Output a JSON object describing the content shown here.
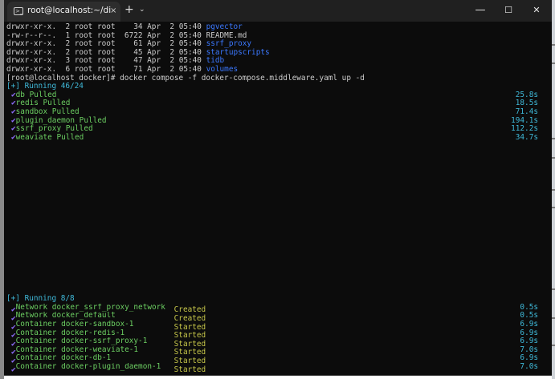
{
  "window": {
    "tab_title": "root@localhost:~/dify/docker",
    "tab_close": "×",
    "new_tab": "+",
    "tab_dropdown": "⌄",
    "minimize": "—",
    "maximize": "☐",
    "close": "✕"
  },
  "listing": [
    {
      "perms": "drwxr-xr-x.",
      "links": "2",
      "owner": "root",
      "group": "root",
      "size": "34",
      "month": "Apr",
      "day": "2",
      "time": "05:40",
      "name": "pgvector",
      "color": "#3b78ff"
    },
    {
      "perms": "-rw-r--r--.",
      "links": "1",
      "owner": "root",
      "group": "root",
      "size": "6722",
      "month": "Apr",
      "day": "2",
      "time": "05:40",
      "name": "README.md",
      "color": "#cccccc"
    },
    {
      "perms": "drwxr-xr-x.",
      "links": "2",
      "owner": "root",
      "group": "root",
      "size": "61",
      "month": "Apr",
      "day": "2",
      "time": "05:40",
      "name": "ssrf_proxy",
      "color": "#3b78ff"
    },
    {
      "perms": "drwxr-xr-x.",
      "links": "2",
      "owner": "root",
      "group": "root",
      "size": "45",
      "month": "Apr",
      "day": "2",
      "time": "05:40",
      "name": "startupscripts",
      "color": "#3b78ff"
    },
    {
      "perms": "drwxr-xr-x.",
      "links": "3",
      "owner": "root",
      "group": "root",
      "size": "47",
      "month": "Apr",
      "day": "2",
      "time": "05:40",
      "name": "tidb",
      "color": "#3b78ff"
    },
    {
      "perms": "drwxr-xr-x.",
      "links": "6",
      "owner": "root",
      "group": "root",
      "size": "71",
      "month": "Apr",
      "day": "2",
      "time": "05:40",
      "name": "volumes",
      "color": "#3b78ff"
    }
  ],
  "prompt": {
    "text": "[root@localhost docker]# ",
    "command": "docker compose -f docker-compose.middleware.yaml up -d"
  },
  "pull": {
    "header": "[+] Running 46/24",
    "check": "✔",
    "items": [
      {
        "name": "db Pulled",
        "time": "25.8s"
      },
      {
        "name": "redis Pulled",
        "time": "18.5s"
      },
      {
        "name": "sandbox Pulled",
        "time": "71.4s"
      },
      {
        "name": "plugin_daemon Pulled",
        "time": "194.1s"
      },
      {
        "name": "ssrf_proxy Pulled",
        "time": "112.2s"
      },
      {
        "name": "weaviate Pulled",
        "time": "34.7s"
      }
    ]
  },
  "run": {
    "header": "[+] Running 8/8",
    "check": "✔",
    "items": [
      {
        "name": "Network docker_ssrf_proxy_network",
        "status": "Created",
        "time": "0.5s"
      },
      {
        "name": "Network docker_default",
        "status": "Created",
        "time": "0.5s"
      },
      {
        "name": "Container docker-sandbox-1",
        "status": "Started",
        "time": "6.9s"
      },
      {
        "name": "Container docker-redis-1",
        "status": "Started",
        "time": "6.9s"
      },
      {
        "name": "Container docker-ssrf_proxy-1",
        "status": "Started",
        "time": "6.9s"
      },
      {
        "name": "Container docker-weaviate-1",
        "status": "Started",
        "time": "7.0s"
      },
      {
        "name": "Container docker-db-1",
        "status": "Started",
        "time": "6.9s"
      },
      {
        "name": "Container docker-plugin_daemon-1",
        "status": "Started",
        "time": "7.0s"
      }
    ]
  },
  "colors": {
    "background": "#0c0c0c",
    "titlebar": "#202020",
    "directory": "#3b78ff",
    "success": "#6ccf62",
    "timing": "#3fb9d9",
    "check": "#8f6fff"
  }
}
